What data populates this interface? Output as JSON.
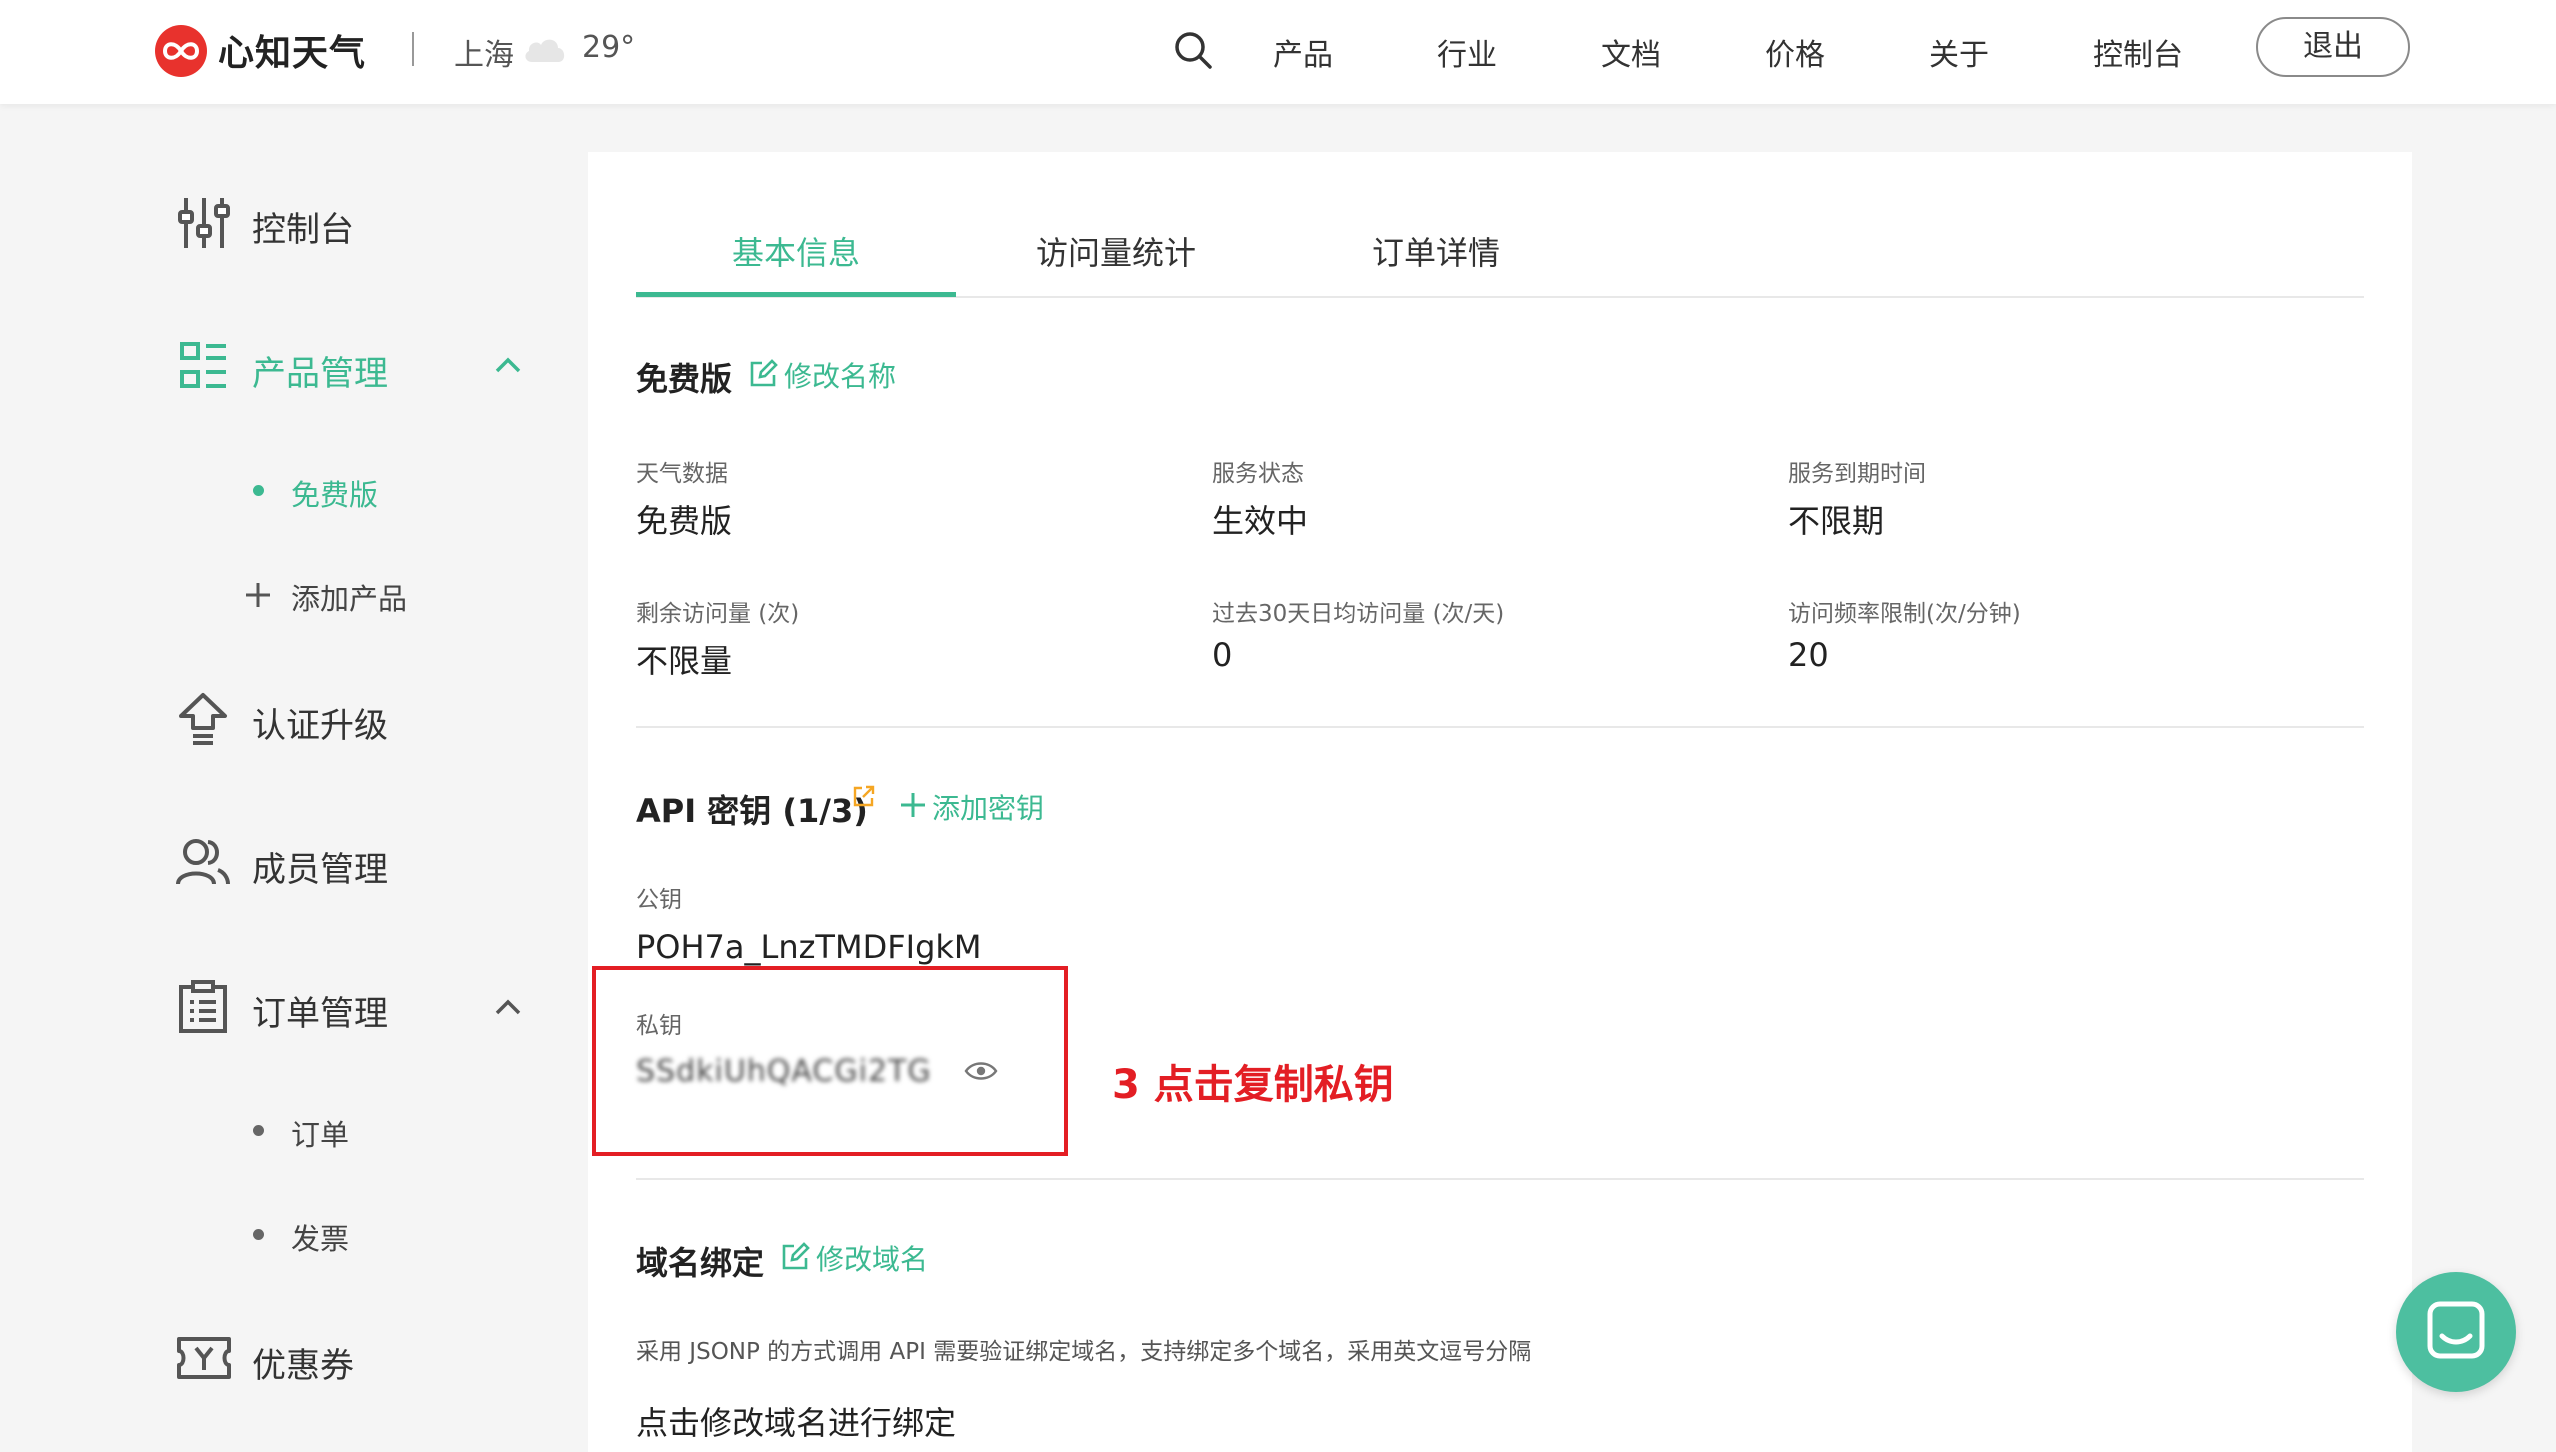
{
  "header": {
    "logo_text": "心知天气",
    "city": "上海",
    "weather_icon": "cloud-icon",
    "temperature": "29°",
    "nav": [
      "产品",
      "行业",
      "文档",
      "价格",
      "关于",
      "控制台"
    ],
    "logout_label": "退出"
  },
  "sidebar": {
    "items": [
      {
        "label": "控制台",
        "icon": "sliders-icon"
      },
      {
        "label": "产品管理",
        "icon": "grid-list-icon",
        "expanded": true,
        "active": true,
        "children": [
          {
            "label": "免费版",
            "active": true
          },
          {
            "label": "添加产品",
            "icon": "plus-icon"
          }
        ]
      },
      {
        "label": "认证升级",
        "icon": "upgrade-icon"
      },
      {
        "label": "成员管理",
        "icon": "users-icon"
      },
      {
        "label": "订单管理",
        "icon": "clipboard-icon",
        "expanded": true,
        "children": [
          {
            "label": "订单"
          },
          {
            "label": "发票"
          }
        ]
      },
      {
        "label": "优惠券",
        "icon": "ticket-icon"
      }
    ]
  },
  "tabs": [
    {
      "label": "基本信息",
      "active": true
    },
    {
      "label": "访问量统计"
    },
    {
      "label": "订单详情"
    }
  ],
  "plan": {
    "title": "免费版",
    "rename_link": "修改名称",
    "fields": [
      {
        "label": "天气数据",
        "value": "免费版"
      },
      {
        "label": "服务状态",
        "value": "生效中"
      },
      {
        "label": "服务到期时间",
        "value": "不限期"
      },
      {
        "label": "剩余访问量 (次)",
        "value": "不限量"
      },
      {
        "label": "过去30天日均访问量 (次/天)",
        "value": "0"
      },
      {
        "label": "访问频率限制(次/分钟)",
        "value": "20"
      }
    ]
  },
  "api_keys": {
    "title": "API 密钥 (1/3)",
    "add_link": "添加密钥",
    "public_key_label": "公钥",
    "public_key_value": "POH7a_LnzTMDFIgkM",
    "private_key_label": "私钥",
    "private_key_masked": "SSdkiUhQACGi2TG",
    "annotation": "3 点击复制私钥"
  },
  "domain": {
    "title": "域名绑定",
    "edit_link": "修改域名",
    "description": "采用 JSONP 的方式调用 API 需要验证绑定域名，支持绑定多个域名，采用英文逗号分隔",
    "bottom_text": "点击修改域名进行绑定"
  },
  "colors": {
    "accent": "#3cb991",
    "brand": "#e8322d",
    "annotation": "#e31e24"
  }
}
